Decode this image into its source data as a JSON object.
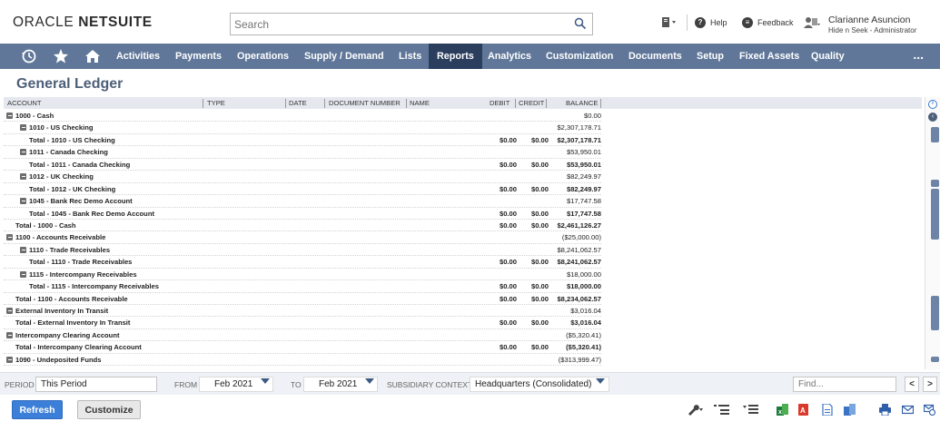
{
  "header": {
    "logo_light": "ORACLE ",
    "logo_bold": "NETSUITE",
    "search_placeholder": "Search",
    "help": "Help",
    "feedback": "Feedback",
    "user_name": "Clarianne Asuncion",
    "user_role": "Hide n Seek - Administrator"
  },
  "nav": {
    "items": [
      "Activities",
      "Payments",
      "Operations",
      "Supply / Demand",
      "Lists",
      "Reports",
      "Analytics",
      "Customization",
      "Documents",
      "Setup",
      "Fixed Assets",
      "Quality"
    ],
    "active": "Reports",
    "more": "...",
    "bar_color": "#607799",
    "active_color": "#2b3e5e"
  },
  "page": {
    "title": "General Ledger"
  },
  "columns": {
    "account": "ACCOUNT",
    "type": "TYPE",
    "date": "DATE",
    "document_number": "DOCUMENT NUMBER",
    "name": "NAME",
    "debit": "DEBIT",
    "credit": "CREDIT",
    "balance": "BALANCE"
  },
  "rows": [
    {
      "account": "1000 - Cash",
      "level": 0,
      "collapsible": true,
      "debit": "",
      "credit": "",
      "balance": "$0.00"
    },
    {
      "account": "1010 - US Checking",
      "level": 1,
      "collapsible": true,
      "debit": "",
      "credit": "",
      "balance": "$2,307,178.71"
    },
    {
      "account": "Total - 1010 - US Checking",
      "level": 2,
      "total": true,
      "debit": "$0.00",
      "credit": "$0.00",
      "balance": "$2,307,178.71"
    },
    {
      "account": "1011 - Canada Checking",
      "level": 1,
      "collapsible": true,
      "debit": "",
      "credit": "",
      "balance": "$53,950.01"
    },
    {
      "account": "Total - 1011 - Canada Checking",
      "level": 2,
      "total": true,
      "debit": "$0.00",
      "credit": "$0.00",
      "balance": "$53,950.01"
    },
    {
      "account": "1012 - UK Checking",
      "level": 1,
      "collapsible": true,
      "debit": "",
      "credit": "",
      "balance": "$82,249.97"
    },
    {
      "account": "Total - 1012 - UK Checking",
      "level": 2,
      "total": true,
      "debit": "$0.00",
      "credit": "$0.00",
      "balance": "$82,249.97"
    },
    {
      "account": "1045 - Bank Rec Demo Account",
      "level": 1,
      "collapsible": true,
      "debit": "",
      "credit": "",
      "balance": "$17,747.58"
    },
    {
      "account": "Total - 1045 - Bank Rec Demo Account",
      "level": 2,
      "total": true,
      "debit": "$0.00",
      "credit": "$0.00",
      "balance": "$17,747.58"
    },
    {
      "account": "Total - 1000 - Cash",
      "level": 1,
      "total": true,
      "debit": "$0.00",
      "credit": "$0.00",
      "balance": "$2,461,126.27"
    },
    {
      "account": "1100 - Accounts Receivable",
      "level": 0,
      "collapsible": true,
      "debit": "",
      "credit": "",
      "balance": "($25,000.00)"
    },
    {
      "account": "1110 - Trade Receivables",
      "level": 1,
      "collapsible": true,
      "debit": "",
      "credit": "",
      "balance": "$8,241,062.57"
    },
    {
      "account": "Total - 1110 - Trade Receivables",
      "level": 2,
      "total": true,
      "debit": "$0.00",
      "credit": "$0.00",
      "balance": "$8,241,062.57"
    },
    {
      "account": "1115 - Intercompany Receivables",
      "level": 1,
      "collapsible": true,
      "debit": "",
      "credit": "",
      "balance": "$18,000.00"
    },
    {
      "account": "Total - 1115 - Intercompany Receivables",
      "level": 2,
      "total": true,
      "debit": "$0.00",
      "credit": "$0.00",
      "balance": "$18,000.00"
    },
    {
      "account": "Total - 1100 - Accounts Receivable",
      "level": 1,
      "total": true,
      "debit": "$0.00",
      "credit": "$0.00",
      "balance": "$8,234,062.57"
    },
    {
      "account": "External Inventory In Transit",
      "level": 0,
      "collapsible": true,
      "debit": "",
      "credit": "",
      "balance": "$3,016.04"
    },
    {
      "account": "Total - External Inventory In Transit",
      "level": 1,
      "total": true,
      "debit": "$0.00",
      "credit": "$0.00",
      "balance": "$3,016.04"
    },
    {
      "account": "Intercompany Clearing Account",
      "level": 0,
      "collapsible": true,
      "debit": "",
      "credit": "",
      "balance": "($5,320.41)"
    },
    {
      "account": "Total - Intercompany Clearing Account",
      "level": 1,
      "total": true,
      "debit": "$0.00",
      "credit": "$0.00",
      "balance": "($5,320.41)"
    },
    {
      "account": "1090 - Undeposited Funds",
      "level": 0,
      "collapsible": true,
      "debit": "",
      "credit": "",
      "balance": "($313,999.47)"
    }
  ],
  "filters": {
    "period_label": "PERIOD",
    "period_value": "This Period",
    "from_label": "FROM",
    "from_value": "Feb 2021",
    "to_label": "TO",
    "to_value": "Feb 2021",
    "subsidiary_label": "SUBSIDIARY CONTEXT",
    "subsidiary_value": "Headquarters (Consolidated)",
    "find_placeholder": "Find...",
    "prev": "<",
    "next": ">"
  },
  "buttons": {
    "refresh": "Refresh",
    "customize": "Customize"
  }
}
